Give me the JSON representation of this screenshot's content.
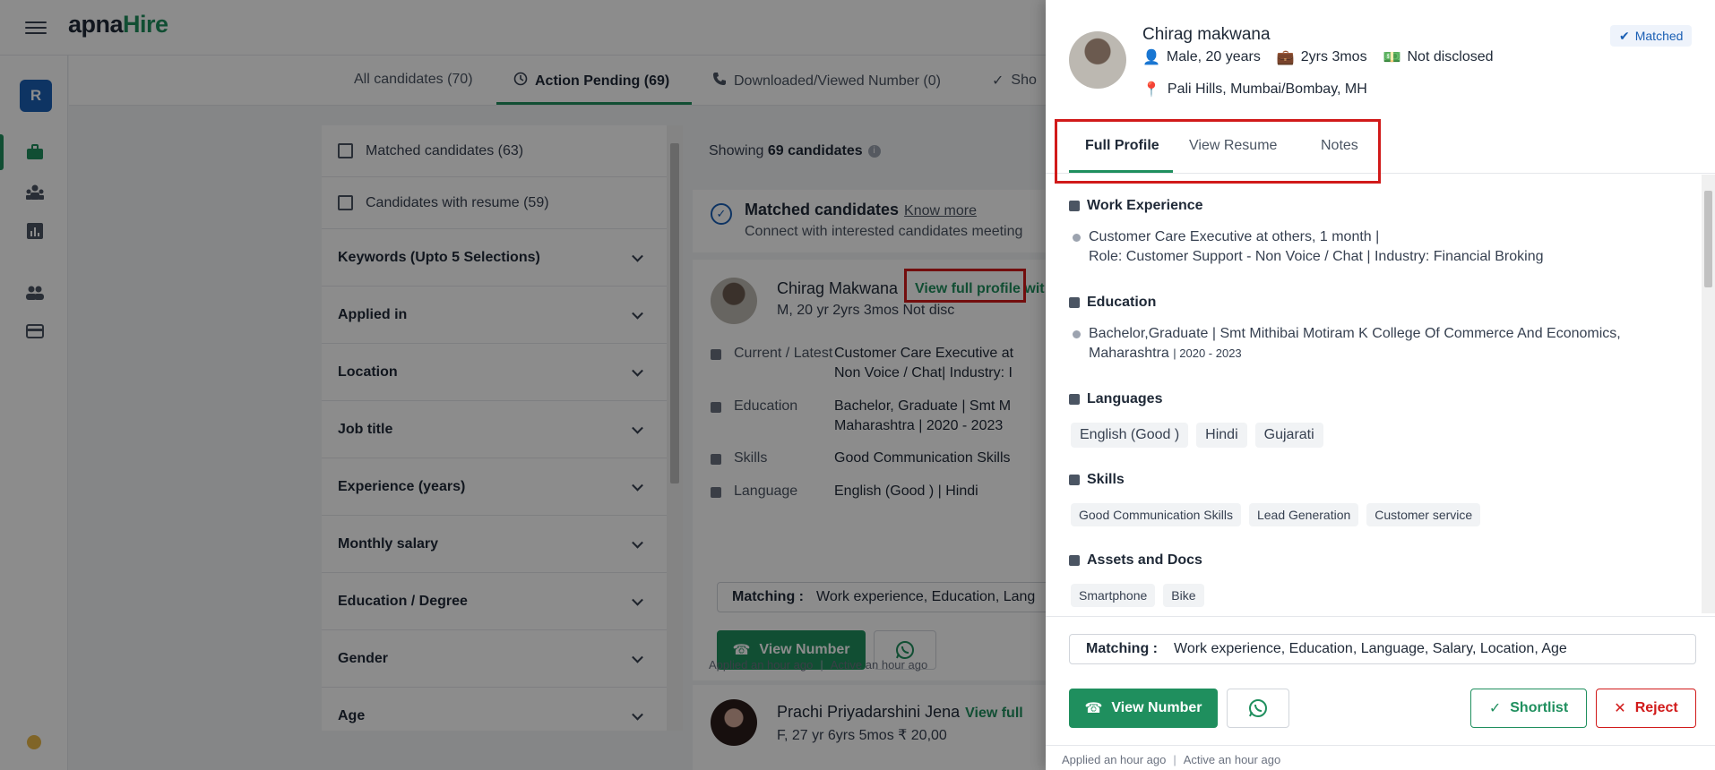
{
  "brand": {
    "part1": "apna",
    "part2": "Hire"
  },
  "user_initial": "R",
  "tabs": [
    {
      "label": "All candidates (70)"
    },
    {
      "label": "Action Pending (69)"
    },
    {
      "label": "Downloaded/Viewed Number (0)"
    },
    {
      "label": "Sho"
    }
  ],
  "filters": {
    "checkboxes": [
      {
        "label": "Matched candidates (63)"
      },
      {
        "label": "Candidates with resume (59)"
      }
    ],
    "sections": [
      {
        "label": "Keywords (Upto 5 Selections)"
      },
      {
        "label": "Applied in"
      },
      {
        "label": "Location"
      },
      {
        "label": "Job title"
      },
      {
        "label": "Experience (years)"
      },
      {
        "label": "Monthly salary"
      },
      {
        "label": "Education / Degree"
      },
      {
        "label": "Gender"
      },
      {
        "label": "Age"
      }
    ]
  },
  "list": {
    "showing_prefix": "Showing",
    "showing_count": "69 candidates",
    "banner_title": "Matched candidates",
    "banner_link": "Know more",
    "banner_sub": "Connect with interested candidates meeting",
    "card1": {
      "name": "Chirag Makwana",
      "view_full": "View full profile wit",
      "meta": "M, 20 yr    2yrs 3mos    Not disc",
      "rows": [
        {
          "key": "Current / Latest",
          "value": "Customer Care Executive at",
          "value2": "Non Voice / Chat| Industry: I"
        },
        {
          "key": "Education",
          "value": "Bachelor, Graduate  | Smt M",
          "value2": "Maharashtra | 2020 - 2023"
        },
        {
          "key": "Skills",
          "value": "Good Communication Skills"
        },
        {
          "key": "Language",
          "value": "English (Good    )   |   Hindi"
        }
      ],
      "matching_label": "Matching :",
      "matching_value": "Work experience, Education, Lang",
      "view_number": "View Number",
      "applied": "Applied an hour ago",
      "active": "Active an hour ago"
    },
    "card2": {
      "name": "Prachi Priyadarshini Jena",
      "view_full": "View full",
      "meta": "F, 27 yr    6yrs 5mos    ₹ 20,00"
    }
  },
  "drawer": {
    "name": "Chirag makwana",
    "gender_age": "Male, 20 years",
    "experience": "2yrs 3mos",
    "salary": "Not disclosed",
    "location": "Pali Hills, Mumbai/Bombay, MH",
    "badge": "Matched",
    "tabs": [
      "Full Profile",
      "View Resume",
      "Notes"
    ],
    "work_title": "Work Experience",
    "work_line1": "Customer Care Executive at others, 1 month  |",
    "work_line2": "Role: Customer Support - Non Voice / Chat  |  Industry: Financial Broking",
    "edu_title": "Education",
    "edu_line1": "Bachelor,Graduate | Smt Mithibai Motiram K College Of Commerce And Economics,",
    "edu_line2": "Maharashtra",
    "edu_years": "| 2020 - 2023",
    "lang_title": "Languages",
    "languages": [
      "English (Good    )",
      "Hindi",
      "Gujarati"
    ],
    "skills_title": "Skills",
    "skills": [
      "Good Communication Skills",
      "Lead Generation",
      "Customer service"
    ],
    "assets_title": "Assets and Docs",
    "assets": [
      "Smartphone",
      "Bike"
    ],
    "matching_label": "Matching :",
    "matching_value": "Work experience, Education, Language, Salary, Location, Age",
    "view_number": "View Number",
    "shortlist": "Shortlist",
    "reject": "Reject",
    "applied": "Applied an hour ago",
    "active": "Active an hour ago"
  },
  "colors": {
    "brand_green": "#1f8f5e",
    "brand_blue": "#1a5fb4",
    "reject_red": "#d11a1a",
    "highlight_red": "#d11a1a"
  }
}
